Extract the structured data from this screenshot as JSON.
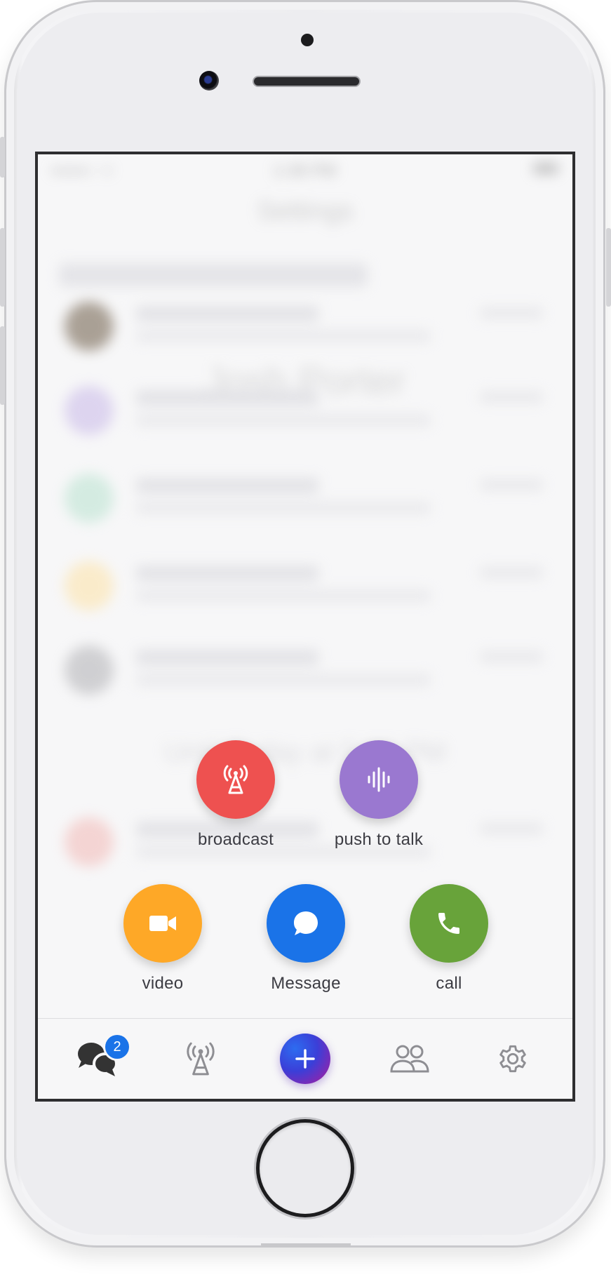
{
  "blurred_background": {
    "status_time": "1:38 PM",
    "status_left": "●●●●○ ≎",
    "title": "Settings",
    "name": "Josh Porter",
    "until": "Until Today at 5:00 PM"
  },
  "actions": {
    "broadcast": {
      "label": "broadcast",
      "icon": "broadcast-tower-icon",
      "color": "#ee5150"
    },
    "push_to_talk": {
      "label": "push to talk",
      "icon": "audio-wave-icon",
      "color": "#9a78d0"
    },
    "video": {
      "label": "video",
      "icon": "video-camera-icon",
      "color": "#fea827"
    },
    "message": {
      "label": "Message",
      "icon": "chat-bubble-icon",
      "color": "#1a73e8"
    },
    "call": {
      "label": "call",
      "icon": "phone-icon",
      "color": "#68a33a"
    }
  },
  "tabbar": {
    "chats": {
      "icon": "chats-icon",
      "badge": "2",
      "badge_color": "#1a73e8"
    },
    "broadcast": {
      "icon": "broadcast-tower-icon"
    },
    "new": {
      "icon": "plus-icon"
    },
    "contacts": {
      "icon": "people-icon"
    },
    "settings": {
      "icon": "gear-icon"
    }
  }
}
